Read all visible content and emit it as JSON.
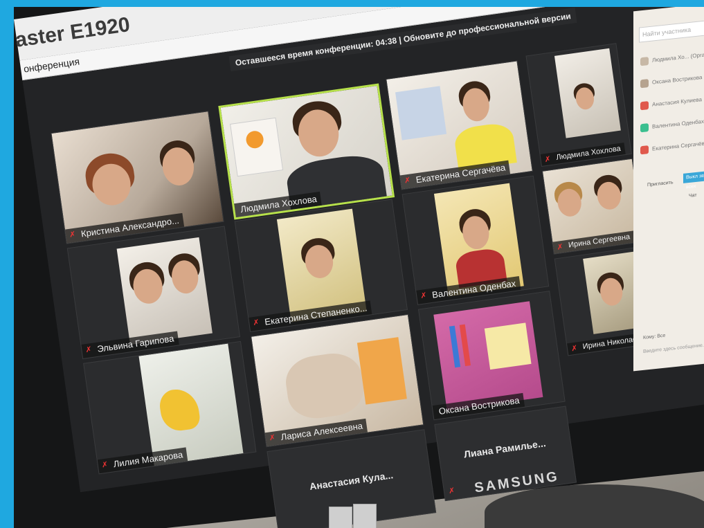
{
  "window": {
    "app_name": "aster E1920",
    "conference_label": "онференция"
  },
  "timer_text": "Оставшееся время конференции: 04:38 | Обновите до профессиональной версии",
  "participants": [
    {
      "name": "Кристина Александро...",
      "muted": true
    },
    {
      "name": "Людмила Хохлова",
      "muted": false,
      "active": true
    },
    {
      "name": "Екатерина Сергачёва",
      "muted": true
    },
    {
      "name": "Людмила Хохлова",
      "muted": true
    },
    {
      "name": "Ирина Сергеевна",
      "muted": true
    },
    {
      "name": "Валентина Оденбах",
      "muted": true
    },
    {
      "name": "Екатерина Степаненко...",
      "muted": true
    },
    {
      "name": "Эльвина Гарипова",
      "muted": true
    },
    {
      "name": "Ирина Николаева",
      "muted": true
    },
    {
      "name": "Оксана Вострикова",
      "muted": false
    },
    {
      "name": "Лариса Алексеевна",
      "muted": true
    },
    {
      "name": "Лилия Макарова",
      "muted": true
    },
    {
      "name": "Анастасия Кула...",
      "muted": false,
      "video_off": true
    },
    {
      "name": "Лиана Рамилье...",
      "muted": true,
      "video_off": true
    }
  ],
  "sidebar": {
    "search_placeholder": "Найти участника",
    "items": [
      {
        "label": "Людмила Хо... (Организатор)",
        "color": "#c7b8a6"
      },
      {
        "label": "Оксана Вострикова",
        "color": "#b6a38f"
      },
      {
        "label": "Анастасия Кулиева",
        "color": "#e0594c"
      },
      {
        "label": "Валентина Оденбах",
        "color": "#3bbf8f"
      },
      {
        "label": "Екатерина Сергачёва",
        "color": "#e0594c"
      }
    ],
    "invite_label": "Пригласить",
    "all_button": "Выкл звук для всех",
    "chat_label": "Чат",
    "to_label": "Кому: Все",
    "message_placeholder": "Введите здесь сообщение..."
  },
  "monitor_brand": "SAMSUNG",
  "colors": {
    "active_border": "#b7e14a",
    "muted_icon": "#e33333",
    "outer_frame": "#1fa8e0"
  }
}
